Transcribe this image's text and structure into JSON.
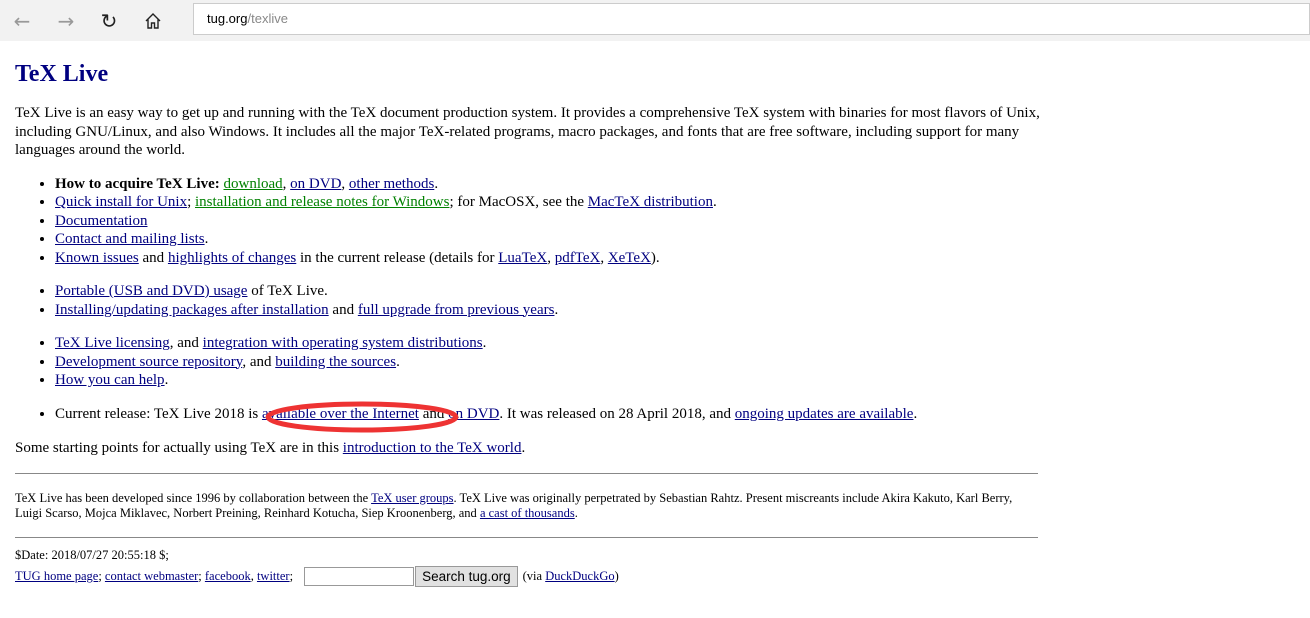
{
  "browser": {
    "url_host": "tug.org",
    "url_path": "/texlive",
    "icons": {
      "back": "arrow-left-icon",
      "forward": "arrow-right-icon",
      "refresh": "refresh-icon",
      "home": "home-icon"
    }
  },
  "colors": {
    "link": "#000080",
    "visited": "#008000",
    "heading": "#000080",
    "annotation": "#ee3333"
  },
  "title": "TeX Live",
  "intro": "TeX Live is an easy way to get up and running with the TeX document production system. It provides a comprehensive TeX system with binaries for most flavors of Unix, including GNU/Linux, and also Windows. It includes all the major TeX-related programs, macro packages, and fonts that are free software, including support for many languages around the world.",
  "lists": [
    [
      [
        {
          "t": "How to acquire TeX Live:",
          "bold": true
        },
        {
          "t": " "
        },
        {
          "t": "download",
          "link": true,
          "visited": true
        },
        {
          "t": ", "
        },
        {
          "t": "on DVD",
          "link": true
        },
        {
          "t": ", "
        },
        {
          "t": "other methods",
          "link": true
        },
        {
          "t": "."
        }
      ],
      [
        {
          "t": "Quick install for Unix",
          "link": true
        },
        {
          "t": "; "
        },
        {
          "t": "installation and release notes for Windows",
          "link": true,
          "visited": true
        },
        {
          "t": "; for MacOSX, see the "
        },
        {
          "t": "MacTeX distribution",
          "link": true
        },
        {
          "t": "."
        }
      ],
      [
        {
          "t": "Documentation",
          "link": true
        }
      ],
      [
        {
          "t": "Contact and mailing lists",
          "link": true
        },
        {
          "t": "."
        }
      ],
      [
        {
          "t": "Known issues",
          "link": true
        },
        {
          "t": " and "
        },
        {
          "t": "highlights of changes",
          "link": true
        },
        {
          "t": " in the current release (details for "
        },
        {
          "t": "LuaTeX",
          "link": true
        },
        {
          "t": ", "
        },
        {
          "t": "pdfTeX",
          "link": true
        },
        {
          "t": ", "
        },
        {
          "t": "XeTeX",
          "link": true
        },
        {
          "t": ")."
        }
      ]
    ],
    [
      [
        {
          "t": "Portable (USB and DVD) usage",
          "link": true
        },
        {
          "t": " of TeX Live."
        }
      ],
      [
        {
          "t": "Installing/updating packages after installation",
          "link": true
        },
        {
          "t": " and "
        },
        {
          "t": "full upgrade from previous years",
          "link": true
        },
        {
          "t": "."
        }
      ]
    ],
    [
      [
        {
          "t": "TeX Live licensing",
          "link": true
        },
        {
          "t": ", and "
        },
        {
          "t": "integration with operating system distributions",
          "link": true
        },
        {
          "t": "."
        }
      ],
      [
        {
          "t": "Development source repository",
          "link": true
        },
        {
          "t": ", and "
        },
        {
          "t": "building the sources",
          "link": true
        },
        {
          "t": "."
        }
      ],
      [
        {
          "t": "How you can help",
          "link": true
        },
        {
          "t": "."
        }
      ]
    ],
    [
      [
        {
          "t": "Current release: TeX Live 2018 is "
        },
        {
          "t": "available over the Internet",
          "link": true
        },
        {
          "t": " and "
        },
        {
          "t": "on DVD",
          "link": true
        },
        {
          "t": ". It was released on 28 April 2018, and "
        },
        {
          "t": "ongoing updates are available",
          "link": true
        },
        {
          "t": "."
        }
      ]
    ]
  ],
  "after": [
    {
      "t": "Some starting points for actually using TeX are in this "
    },
    {
      "t": "introduction to the TeX world",
      "link": true
    },
    {
      "t": "."
    }
  ],
  "credits": [
    {
      "t": "TeX Live has been developed since 1996 by collaboration between the "
    },
    {
      "t": "TeX user groups",
      "link": true
    },
    {
      "t": ". TeX Live was originally perpetrated by Sebastian Rahtz. Present miscreants include Akira Kakuto, Karl Berry, Luigi Scarso, Mojca Miklavec, Norbert Preining, Reinhard Kotucha, Siep Kroonenberg, and "
    },
    {
      "t": "a cast of thousands",
      "link": true
    },
    {
      "t": "."
    }
  ],
  "footer": {
    "date": "$Date: 2018/07/27 20:55:18 $;",
    "links": [
      {
        "t": "TUG home page",
        "link": true
      },
      {
        "t": "; "
      },
      {
        "t": "contact webmaster",
        "link": true
      },
      {
        "t": "; "
      },
      {
        "t": "facebook",
        "link": true
      },
      {
        "t": ", "
      },
      {
        "t": "twitter",
        "link": true
      },
      {
        "t": ";"
      }
    ],
    "search_value": "",
    "search_button": "Search tug.org",
    "via": [
      {
        "t": "(via "
      },
      {
        "t": "DuckDuckGo",
        "link": true
      },
      {
        "t": ")"
      }
    ]
  }
}
